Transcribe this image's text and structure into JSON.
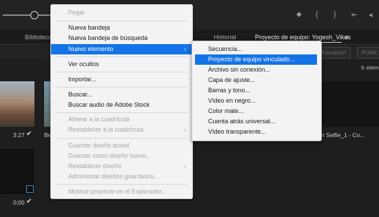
{
  "menu": {
    "items": [
      {
        "label": "Pegar",
        "enabled": false
      },
      {
        "label": "Nueva bandeja",
        "enabled": true
      },
      {
        "label": "Nueva bandeja de búsqueda",
        "enabled": true
      },
      {
        "label": "Nuevo elemento",
        "enabled": true,
        "highlighted": true,
        "submenu": true
      },
      {
        "label": "Ver ocultos",
        "enabled": true
      },
      {
        "label": "Importar...",
        "enabled": true
      },
      {
        "label": "Buscar...",
        "enabled": true
      },
      {
        "label": "Buscar audio de Adobe Stock",
        "enabled": true
      },
      {
        "label": "Alinear a la cuadrícula",
        "enabled": false
      },
      {
        "label": "Restablecer a la cuadrícula",
        "enabled": false,
        "submenu": true
      },
      {
        "label": "Guardar diseño actual",
        "enabled": false
      },
      {
        "label": "Guardar como diseño nuevo...",
        "enabled": false
      },
      {
        "label": "Restablecer diseño",
        "enabled": false,
        "submenu": true
      },
      {
        "label": "Administrar diseños guardados...",
        "enabled": false
      },
      {
        "label": "Mostrar proyecto en el Explorador...",
        "enabled": false
      }
    ]
  },
  "submenu": {
    "items": [
      {
        "label": "Secuencia..."
      },
      {
        "label": "Proyecto de equipo vinculado...",
        "highlighted": true
      },
      {
        "label": "Archivo sin conexión..."
      },
      {
        "label": "Capa de ajuste..."
      },
      {
        "label": "Barras y tono..."
      },
      {
        "label": "Vídeo en negro..."
      },
      {
        "label": "Color mate..."
      },
      {
        "label": "Cuenta atrás universal..."
      },
      {
        "label": "Vídeo transparente..."
      }
    ]
  },
  "panel": {
    "tabs": {
      "left_partial": "Biblioteca",
      "historial": "Historial",
      "project": "Proyecto de equipo: Yogesh_Vikas"
    },
    "tab_menu_icon": "≡",
    "buttons": {
      "actualizar": "Actualizar",
      "publicar": "Public"
    },
    "element_count": "6 elem"
  },
  "thumbnails": {
    "item1_duration": "3:27",
    "item2_label_partial": "Be",
    "item3_duration": "0;00",
    "item4_label_partial": "n Selfie_1 - Co..."
  },
  "colors": {
    "highlight": "#1473e6",
    "menu_bg": "#f3f3f3",
    "app_bg": "#1e1e1e"
  }
}
